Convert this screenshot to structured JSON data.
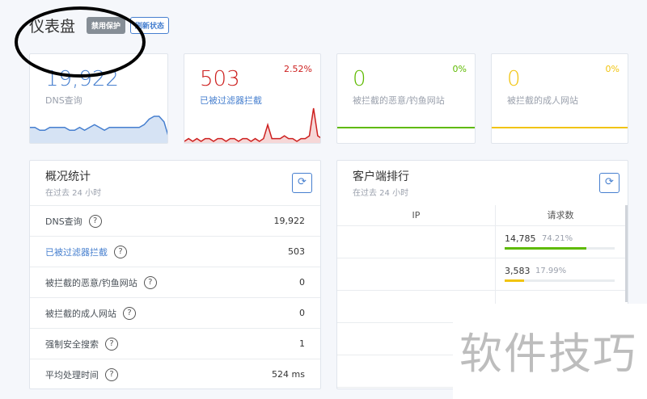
{
  "header": {
    "title": "仪表盘",
    "disable_button": "禁用保护",
    "refresh_button": "刷新状态"
  },
  "stat_cards": [
    {
      "value": "19,922",
      "label": "DNS查询",
      "percent": "",
      "color": "#467fcf",
      "series": [
        5,
        5,
        4,
        4,
        5,
        5,
        5,
        5,
        4,
        4,
        5,
        4,
        5,
        6,
        5,
        4,
        5,
        5,
        5,
        5,
        5,
        5,
        5,
        6,
        8,
        9,
        9,
        7,
        1
      ]
    },
    {
      "value": "503",
      "label": "已被过滤器拦截",
      "percent": "2.52%",
      "color": "#cd201f",
      "series": [
        0,
        1,
        0,
        1,
        0,
        1,
        1,
        0,
        1,
        1,
        0,
        1,
        1,
        0,
        1,
        1,
        0,
        1,
        0,
        1,
        6,
        1,
        1,
        1,
        2,
        1,
        1,
        0,
        1,
        1,
        2,
        12,
        2,
        1
      ]
    },
    {
      "value": "0",
      "label": "被拦截的恶意/钓鱼网站",
      "percent": "0%",
      "color": "#5eba00"
    },
    {
      "value": "0",
      "label": "被拦截的成人网站",
      "percent": "0%",
      "color": "#f1c40f"
    }
  ],
  "overview": {
    "title": "概况统计",
    "subtitle": "在过去 24 小时",
    "rows": [
      {
        "label": "DNS查询",
        "value": "19,922"
      },
      {
        "label": "已被过滤器拦截",
        "value": "503"
      },
      {
        "label": "被拦截的恶意/钓鱼网站",
        "value": "0"
      },
      {
        "label": "被拦截的成人网站",
        "value": "0"
      },
      {
        "label": "强制安全搜索",
        "value": "1"
      },
      {
        "label": "平均处理时间",
        "value": "524 ms"
      }
    ]
  },
  "clients": {
    "title": "客户端排行",
    "subtitle": "在过去 24 小时",
    "col_ip": "IP",
    "col_requests": "请求数",
    "rows": [
      {
        "count": "14,785",
        "percent": "74.21%",
        "fraction": 0.7421,
        "color": "#5eba00"
      },
      {
        "count": "3,583",
        "percent": "17.99%",
        "fraction": 0.1799,
        "color": "#f1c40f"
      }
    ]
  },
  "watermark": "软件技巧"
}
